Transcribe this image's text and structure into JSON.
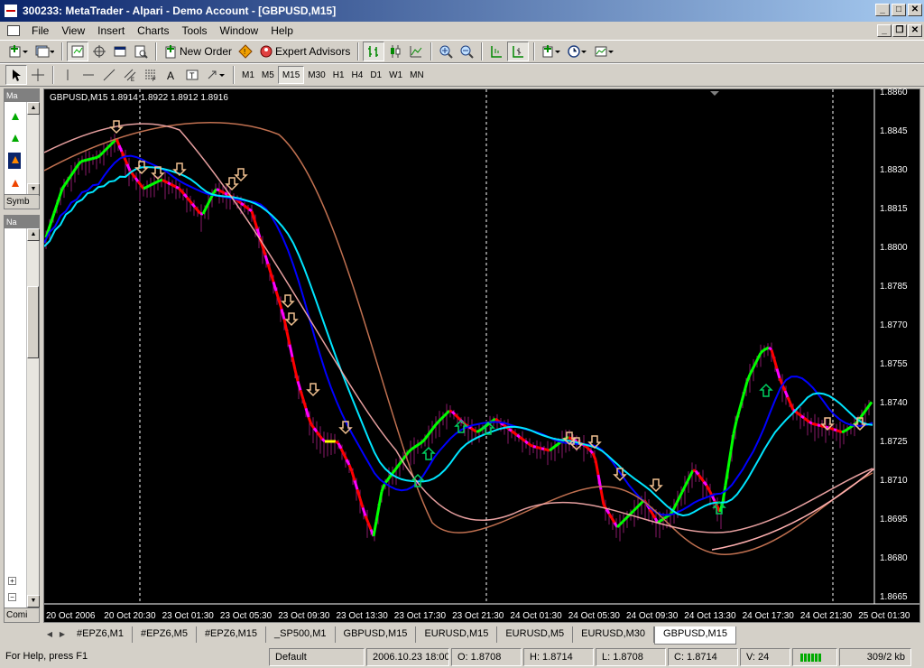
{
  "window": {
    "title": "300233: MetaTrader - Alpari - Demo Account - [GBPUSD,M15]"
  },
  "menu": [
    "File",
    "View",
    "Insert",
    "Charts",
    "Tools",
    "Window",
    "Help"
  ],
  "toolbar": {
    "new_order": "New Order",
    "expert_advisors": "Expert Advisors"
  },
  "timeframes": [
    "M1",
    "M5",
    "M15",
    "M30",
    "H1",
    "H4",
    "D1",
    "W1",
    "MN"
  ],
  "active_timeframe": "M15",
  "left_panels": {
    "market_watch": "Ma",
    "symbol_tab": "Symb",
    "navigator": "Na",
    "common_tab": "Comi"
  },
  "chart": {
    "label": "GBPUSD,M15  1.8914 1.8922 1.8912 1.8916",
    "price_ticks": [
      "1.8860",
      "1.8845",
      "1.8830",
      "1.8815",
      "1.8800",
      "1.8785",
      "1.8770",
      "1.8755",
      "1.8740",
      "1.8725",
      "1.8710",
      "1.8695",
      "1.8680",
      "1.8665"
    ],
    "time_ticks": [
      "20 Oct 2006",
      "20 Oct 20:30",
      "23 Oct 01:30",
      "23 Oct 05:30",
      "23 Oct 09:30",
      "23 Oct 13:30",
      "23 Oct 17:30",
      "23 Oct 21:30",
      "24 Oct 01:30",
      "24 Oct 05:30",
      "24 Oct 09:30",
      "24 Oct 13:30",
      "24 Oct 17:30",
      "24 Oct 21:30",
      "25 Oct 01:30"
    ]
  },
  "chart_tabs": [
    "#EPZ6,M1",
    "#EPZ6,M5",
    "#EPZ6,M15",
    "_SP500,M1",
    "GBPUSD,M15",
    "EURUSD,M15",
    "EURUSD,M5",
    "EURUSD,M30",
    "GBPUSD,M15"
  ],
  "active_tab_index": 8,
  "status": {
    "help": "For Help, press F1",
    "profile": "Default",
    "datetime": "2006.10.23 18:00",
    "open": "O: 1.8708",
    "high": "H: 1.8714",
    "low": "L: 1.8708",
    "close": "C: 1.8714",
    "volume": "V: 24",
    "traffic": "309/2 kb"
  },
  "colors": {
    "background": "#000000",
    "bull": "#00ff00",
    "bear": "#ff0000",
    "trend": "#ffff00",
    "magenta": "#ff00ff",
    "ma_fast": "#0000ff",
    "ma_mid": "#00e5ff",
    "ma_slow": "#c07050",
    "ma_long": "#ffb0b0"
  }
}
